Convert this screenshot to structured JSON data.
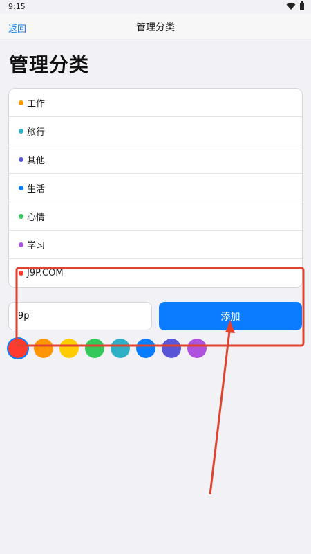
{
  "status": {
    "time": "9:15"
  },
  "nav": {
    "back_label": "返回",
    "title": "管理分类"
  },
  "page": {
    "title": "管理分类"
  },
  "categories": [
    {
      "label": "工作",
      "color": "#ff9500"
    },
    {
      "label": "旅行",
      "color": "#30b0c7"
    },
    {
      "label": "其他",
      "color": "#5856d6"
    },
    {
      "label": "生活",
      "color": "#0a7cff"
    },
    {
      "label": "心情",
      "color": "#34c759"
    },
    {
      "label": "学习",
      "color": "#af52de"
    },
    {
      "label": "J9P.COM",
      "color": "#ff3b30"
    }
  ],
  "new_category": {
    "input_value": "9p",
    "add_label": "添加"
  },
  "color_swatches": [
    {
      "color": "#ff3b30",
      "selected": true
    },
    {
      "color": "#ff9500",
      "selected": false
    },
    {
      "color": "#ffcc00",
      "selected": false
    },
    {
      "color": "#34c759",
      "selected": false
    },
    {
      "color": "#30b0c7",
      "selected": false
    },
    {
      "color": "#0a7cff",
      "selected": false
    },
    {
      "color": "#5856d6",
      "selected": false
    },
    {
      "color": "#af52de",
      "selected": false
    }
  ],
  "annotation": {
    "color": "#e0432f"
  }
}
